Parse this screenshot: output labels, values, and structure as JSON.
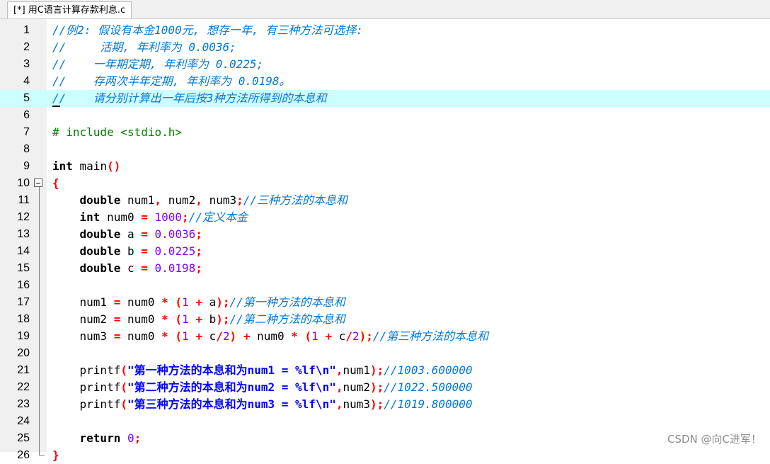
{
  "tab": {
    "title": "[*] 用C语言计算存款利息.c"
  },
  "editor": {
    "lines": [
      {
        "n": "1",
        "segs": [
          {
            "c": "cm",
            "t": "//例2: 假设有本金1000元, 想存一年, 有三种方法可选择:"
          }
        ]
      },
      {
        "n": "2",
        "segs": [
          {
            "c": "cm",
            "t": "//     活期, 年利率为 0.0036;"
          }
        ]
      },
      {
        "n": "3",
        "segs": [
          {
            "c": "cm",
            "t": "//    一年期定期, 年利率为 0.0225;"
          }
        ]
      },
      {
        "n": "4",
        "segs": [
          {
            "c": "cm",
            "t": "//    存两次半年定期, 年利率为 0.0198。"
          }
        ]
      },
      {
        "n": "5",
        "segs": [
          {
            "c": "cm",
            "t": "//    请分别计算出一年后按3种方法所得到的本息和"
          }
        ]
      },
      {
        "n": "6",
        "segs": []
      },
      {
        "n": "7",
        "segs": [
          {
            "c": "pp",
            "t": "# include <stdio.h>"
          }
        ]
      },
      {
        "n": "8",
        "segs": []
      },
      {
        "n": "9",
        "segs": [
          {
            "c": "kw",
            "t": "int"
          },
          {
            "c": "",
            "t": " main"
          },
          {
            "c": "op",
            "t": "()"
          }
        ]
      },
      {
        "n": "10",
        "segs": [
          {
            "c": "op",
            "t": "{"
          }
        ]
      },
      {
        "n": "11",
        "segs": [
          {
            "c": "",
            "t": "    "
          },
          {
            "c": "kw",
            "t": "double"
          },
          {
            "c": "",
            "t": " num1"
          },
          {
            "c": "op",
            "t": ","
          },
          {
            "c": "",
            "t": " num2"
          },
          {
            "c": "op",
            "t": ","
          },
          {
            "c": "",
            "t": " num3"
          },
          {
            "c": "op",
            "t": ";"
          },
          {
            "c": "cm",
            "t": "//三种方法的本息和"
          }
        ]
      },
      {
        "n": "12",
        "segs": [
          {
            "c": "",
            "t": "    "
          },
          {
            "c": "kw",
            "t": "int"
          },
          {
            "c": "",
            "t": " num0 "
          },
          {
            "c": "op",
            "t": "="
          },
          {
            "c": "",
            "t": " "
          },
          {
            "c": "num",
            "t": "1000"
          },
          {
            "c": "op",
            "t": ";"
          },
          {
            "c": "cm",
            "t": "//定义本金"
          }
        ]
      },
      {
        "n": "13",
        "segs": [
          {
            "c": "",
            "t": "    "
          },
          {
            "c": "kw",
            "t": "double"
          },
          {
            "c": "",
            "t": " a "
          },
          {
            "c": "op",
            "t": "="
          },
          {
            "c": "",
            "t": " "
          },
          {
            "c": "num",
            "t": "0.0036"
          },
          {
            "c": "op",
            "t": ";"
          }
        ]
      },
      {
        "n": "14",
        "segs": [
          {
            "c": "",
            "t": "    "
          },
          {
            "c": "kw",
            "t": "double"
          },
          {
            "c": "",
            "t": " b "
          },
          {
            "c": "op",
            "t": "="
          },
          {
            "c": "",
            "t": " "
          },
          {
            "c": "num",
            "t": "0.0225"
          },
          {
            "c": "op",
            "t": ";"
          }
        ]
      },
      {
        "n": "15",
        "segs": [
          {
            "c": "",
            "t": "    "
          },
          {
            "c": "kw",
            "t": "double"
          },
          {
            "c": "",
            "t": " c "
          },
          {
            "c": "op",
            "t": "="
          },
          {
            "c": "",
            "t": " "
          },
          {
            "c": "num",
            "t": "0.0198"
          },
          {
            "c": "op",
            "t": ";"
          }
        ]
      },
      {
        "n": "16",
        "segs": []
      },
      {
        "n": "17",
        "segs": [
          {
            "c": "",
            "t": "    num1 "
          },
          {
            "c": "op",
            "t": "="
          },
          {
            "c": "",
            "t": " num0 "
          },
          {
            "c": "op",
            "t": "*"
          },
          {
            "c": "",
            "t": " "
          },
          {
            "c": "op",
            "t": "("
          },
          {
            "c": "num",
            "t": "1"
          },
          {
            "c": "",
            "t": " "
          },
          {
            "c": "op",
            "t": "+"
          },
          {
            "c": "",
            "t": " a"
          },
          {
            "c": "op",
            "t": ");"
          },
          {
            "c": "cm",
            "t": "//第一种方法的本息和"
          }
        ]
      },
      {
        "n": "18",
        "segs": [
          {
            "c": "",
            "t": "    num2 "
          },
          {
            "c": "op",
            "t": "="
          },
          {
            "c": "",
            "t": " num0 "
          },
          {
            "c": "op",
            "t": "*"
          },
          {
            "c": "",
            "t": " "
          },
          {
            "c": "op",
            "t": "("
          },
          {
            "c": "num",
            "t": "1"
          },
          {
            "c": "",
            "t": " "
          },
          {
            "c": "op",
            "t": "+"
          },
          {
            "c": "",
            "t": " b"
          },
          {
            "c": "op",
            "t": ");"
          },
          {
            "c": "cm",
            "t": "//第二种方法的本息和"
          }
        ]
      },
      {
        "n": "19",
        "segs": [
          {
            "c": "",
            "t": "    num3 "
          },
          {
            "c": "op",
            "t": "="
          },
          {
            "c": "",
            "t": " num0 "
          },
          {
            "c": "op",
            "t": "*"
          },
          {
            "c": "",
            "t": " "
          },
          {
            "c": "op",
            "t": "("
          },
          {
            "c": "num",
            "t": "1"
          },
          {
            "c": "",
            "t": " "
          },
          {
            "c": "op",
            "t": "+"
          },
          {
            "c": "",
            "t": " c"
          },
          {
            "c": "op",
            "t": "/"
          },
          {
            "c": "num",
            "t": "2"
          },
          {
            "c": "op",
            "t": ")"
          },
          {
            "c": "",
            "t": " "
          },
          {
            "c": "op",
            "t": "+"
          },
          {
            "c": "",
            "t": " num0 "
          },
          {
            "c": "op",
            "t": "*"
          },
          {
            "c": "",
            "t": " "
          },
          {
            "c": "op",
            "t": "("
          },
          {
            "c": "num",
            "t": "1"
          },
          {
            "c": "",
            "t": " "
          },
          {
            "c": "op",
            "t": "+"
          },
          {
            "c": "",
            "t": " c"
          },
          {
            "c": "op",
            "t": "/"
          },
          {
            "c": "num",
            "t": "2"
          },
          {
            "c": "op",
            "t": ");"
          },
          {
            "c": "cm",
            "t": "//第三种方法的本息和"
          }
        ]
      },
      {
        "n": "20",
        "segs": []
      },
      {
        "n": "21",
        "segs": [
          {
            "c": "",
            "t": "    printf"
          },
          {
            "c": "op",
            "t": "("
          },
          {
            "c": "str",
            "t": "\"第一种方法的本息和为num1 = %lf\\n\""
          },
          {
            "c": "op",
            "t": ","
          },
          {
            "c": "",
            "t": "num1"
          },
          {
            "c": "op",
            "t": ");"
          },
          {
            "c": "cm",
            "t": "//1003.600000"
          }
        ]
      },
      {
        "n": "22",
        "segs": [
          {
            "c": "",
            "t": "    printf"
          },
          {
            "c": "op",
            "t": "("
          },
          {
            "c": "str",
            "t": "\"第二种方法的本息和为num2 = %lf\\n\""
          },
          {
            "c": "op",
            "t": ","
          },
          {
            "c": "",
            "t": "num2"
          },
          {
            "c": "op",
            "t": ");"
          },
          {
            "c": "cm",
            "t": "//1022.500000"
          }
        ]
      },
      {
        "n": "23",
        "segs": [
          {
            "c": "",
            "t": "    printf"
          },
          {
            "c": "op",
            "t": "("
          },
          {
            "c": "str",
            "t": "\"第三种方法的本息和为num3 = %lf\\n\""
          },
          {
            "c": "op",
            "t": ","
          },
          {
            "c": "",
            "t": "num3"
          },
          {
            "c": "op",
            "t": ");"
          },
          {
            "c": "cm",
            "t": "//1019.800000"
          }
        ]
      },
      {
        "n": "24",
        "segs": []
      },
      {
        "n": "25",
        "segs": [
          {
            "c": "",
            "t": "    "
          },
          {
            "c": "kw",
            "t": "return"
          },
          {
            "c": "",
            "t": " "
          },
          {
            "c": "num",
            "t": "0"
          },
          {
            "c": "op",
            "t": ";"
          }
        ]
      },
      {
        "n": "26",
        "segs": [
          {
            "c": "op",
            "t": "}"
          }
        ]
      }
    ]
  },
  "watermark": {
    "text": "CSDN @向C进军！"
  }
}
